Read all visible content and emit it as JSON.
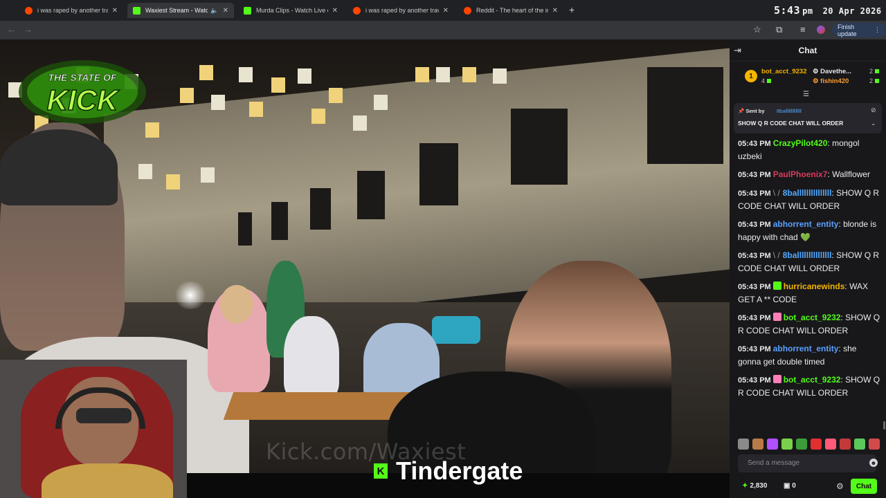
{
  "browser": {
    "tabs": [
      {
        "label": "i was raped by another traveler",
        "icon": "reddit-icon"
      },
      {
        "label": "Waxiest Stream - Watch Live",
        "icon": "kick-icon",
        "active": true,
        "audio": "speaker-icon"
      },
      {
        "label": "Murda Clips - Watch Live on Kick",
        "icon": "kick-icon"
      },
      {
        "label": "i was raped by another traveler",
        "icon": "reddit-icon"
      },
      {
        "label": "Reddit - The heart of the internet",
        "icon": "reddit-icon"
      }
    ],
    "new_tab": "+",
    "finish_update": "Finish update"
  },
  "clock": {
    "time": "5:43",
    "ampm": "pm",
    "date": "20 Apr 2026"
  },
  "video": {
    "logo_line1": "THE STATE OF",
    "logo_line2": "KICK",
    "watermark": "Kick.com/Waxiest",
    "caption": "Tindergate",
    "caption_badge": "K"
  },
  "chat": {
    "title": "Chat",
    "top_gifters": [
      {
        "rank": "1",
        "name": "bot_acct_9232",
        "count": "4",
        "color": "#f4b400"
      },
      {
        "name": "Davethe...",
        "count": "2",
        "color": "#e8e8e8"
      },
      {
        "name": "fishin420",
        "count": "2",
        "color": "#ff9d2e"
      }
    ],
    "pinned": {
      "sent_by": "Sent by",
      "user": "8ballllllllllllll",
      "message": "SHOW Q R CODE CHAT WILL ORDER"
    },
    "messages": [
      {
        "time": "05:43 PM",
        "user": "CrazyPilot420",
        "color": "#53fc18",
        "text": "mongol uzbeki"
      },
      {
        "time": "05:43 PM",
        "user": "PaulPhoenix7",
        "color": "#d83b5b",
        "text": "Wallflower"
      },
      {
        "time": "05:43 PM",
        "prefix": "\\ /",
        "user": "8balllllllllllllll",
        "color": "#53a9ff",
        "text": "SHOW Q R CODE CHAT WILL ORDER"
      },
      {
        "time": "05:43 PM",
        "user": "abhorrent_entity",
        "color": "#5aa0ff",
        "text": "blonde is happy with chad 💚"
      },
      {
        "time": "05:43 PM",
        "prefix": "\\ /",
        "user": "8balllllllllllllll",
        "color": "#53a9ff",
        "text": "SHOW Q R CODE CHAT WILL ORDER"
      },
      {
        "time": "05:43 PM",
        "user": "hurricanewinds",
        "color": "#f4b400",
        "badge": "#53fc18",
        "text": "WAX GET A ** CODE"
      },
      {
        "time": "05:43 PM",
        "user": "bot_acct_9232",
        "color": "#53fc18",
        "badge": "#ff7eb6",
        "text": "SHOW Q R CODE CHAT WILL ORDER"
      },
      {
        "time": "05:43 PM",
        "user": "abhorrent_entity",
        "color": "#5aa0ff",
        "text": "she gonna get double timed"
      },
      {
        "time": "05:43 PM",
        "user": "bot_acct_9232",
        "color": "#53fc18",
        "badge": "#ff7eb6",
        "text": "SHOW Q R CODE CHAT WILL ORDER"
      }
    ],
    "send_placeholder": "Send a message",
    "points": "2,830",
    "zero_count": "0",
    "chat_button": "Chat"
  }
}
